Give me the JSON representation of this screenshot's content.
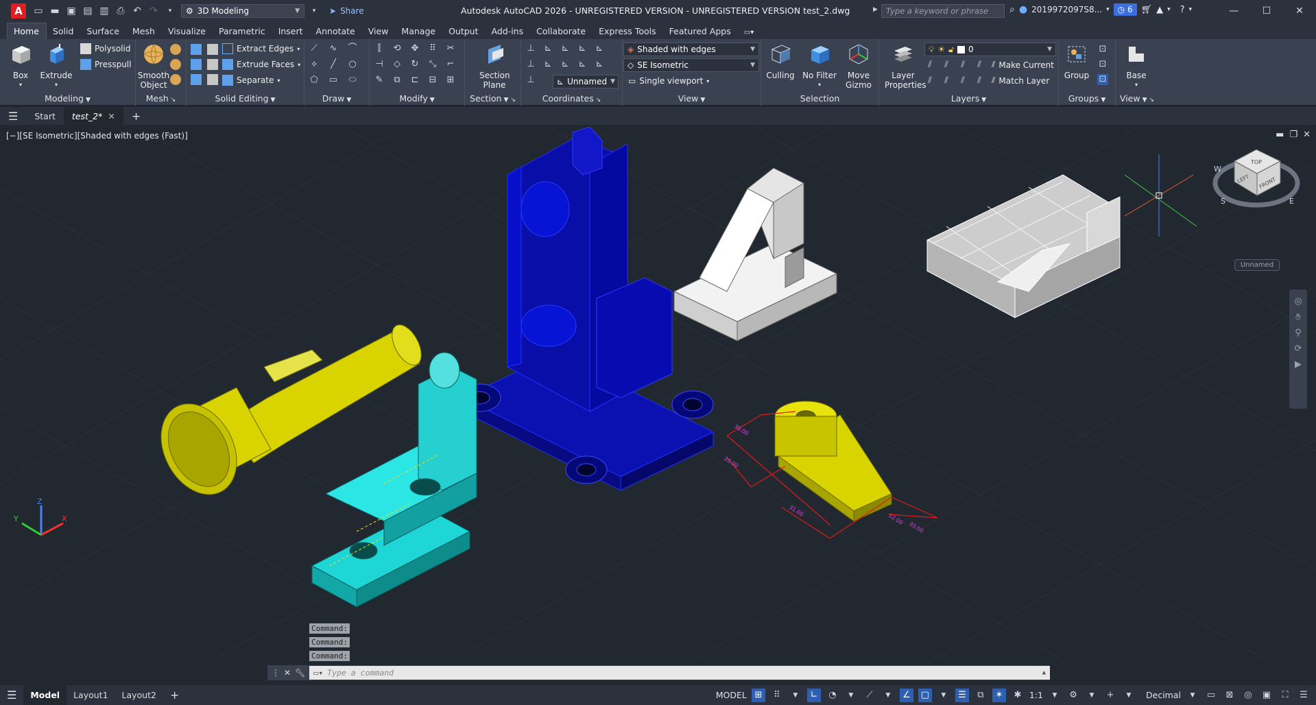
{
  "app": {
    "logo": "A",
    "title": "Autodesk AutoCAD 2026 - UNREGISTERED VERSION - UNREGISTERED VERSION    test_2.dwg",
    "workspace": "3D Modeling",
    "share_label": "Share",
    "search_placeholder": "Type a keyword or phrase",
    "user": "2019972097S8...",
    "clock_count": "6"
  },
  "ribbon_tabs": [
    "Home",
    "Solid",
    "Surface",
    "Mesh",
    "Visualize",
    "Parametric",
    "Insert",
    "Annotate",
    "View",
    "Manage",
    "Output",
    "Add-ins",
    "Collaborate",
    "Express Tools",
    "Featured Apps"
  ],
  "panels": {
    "modeling": {
      "title": "Modeling",
      "box": "Box",
      "extrude": "Extrude",
      "polysolid": "Polysolid",
      "presspull": "Presspull"
    },
    "mesh": {
      "title": "Mesh",
      "smooth_object": "Smooth Object"
    },
    "solid_editing": {
      "title": "Solid Editing",
      "extract_edges": "Extract Edges",
      "extrude_faces": "Extrude Faces",
      "separate": "Separate"
    },
    "draw": {
      "title": "Draw"
    },
    "modify": {
      "title": "Modify"
    },
    "section": {
      "title": "Section",
      "section_plane": "Section Plane"
    },
    "coordinates": {
      "title": "Coordinates",
      "ucs_name": "Unnamed"
    },
    "view": {
      "title": "View",
      "visual_style": "Shaded with edges",
      "view_name": "SE Isometric",
      "viewport_config": "Single viewport"
    },
    "selection": {
      "title": "Selection",
      "culling": "Culling",
      "no_filter": "No Filter",
      "move_gizmo": "Move Gizmo"
    },
    "layers": {
      "title": "Layers",
      "layer_properties": "Layer Properties",
      "current_layer": "0",
      "make_current": "Make Current",
      "match_layer": "Match Layer"
    },
    "groups": {
      "title": "Groups",
      "group": "Group"
    },
    "viewpanel": {
      "title": "View",
      "base": "Base"
    }
  },
  "file_tabs": {
    "start": "Start",
    "active": "test_2*"
  },
  "viewport": {
    "label": "[−][SE Isometric][Shaded with edges (Fast)]",
    "ucs_unnamed": "Unnamed",
    "viewcube": {
      "top": "TOP",
      "front": "FRONT",
      "left": "LEFT",
      "south": "S",
      "west": "W",
      "east": "E"
    },
    "dimensions": [
      "30.00",
      "20.00",
      "31.00",
      "12.00",
      "30.00"
    ],
    "axes": {
      "x": "X",
      "y": "Y",
      "z": "Z"
    }
  },
  "command": {
    "history": [
      "Command:",
      "Command:",
      "Command:"
    ],
    "placeholder": "Type a command"
  },
  "layouts": [
    "Model",
    "Layout1",
    "Layout2"
  ],
  "status": {
    "model": "MODEL",
    "scale": "1:1",
    "units": "Decimal"
  },
  "colors": {
    "blue_part": "#0a0ea8",
    "yellow_part": "#d9d400",
    "cyan_part": "#1fd6d6",
    "white_part": "#e6e6e6",
    "dim_red": "#e01b1b"
  }
}
